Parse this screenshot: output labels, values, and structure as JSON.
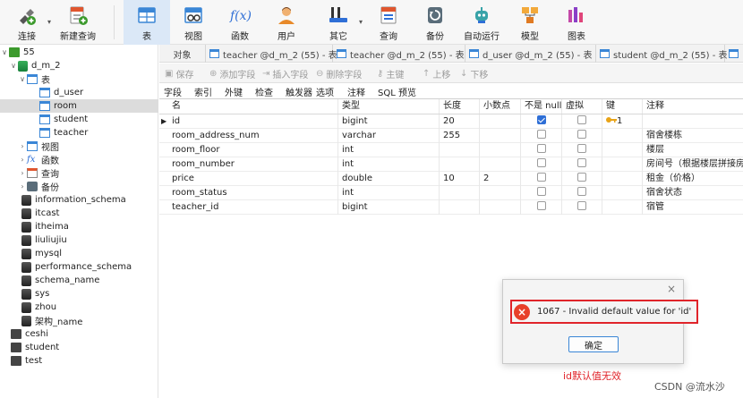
{
  "toolbar": {
    "items": [
      {
        "label": "连接",
        "icon": "connect-icon"
      },
      {
        "label": "新建查询",
        "icon": "new-query-icon"
      },
      {
        "label": "表",
        "icon": "table-icon"
      },
      {
        "label": "视图",
        "icon": "view-icon"
      },
      {
        "label": "函数",
        "icon": "function-icon",
        "glyph": "f(x)"
      },
      {
        "label": "用户",
        "icon": "user-icon"
      },
      {
        "label": "其它",
        "icon": "tools-icon"
      },
      {
        "label": "查询",
        "icon": "query-icon"
      },
      {
        "label": "备份",
        "icon": "backup-icon"
      },
      {
        "label": "自动运行",
        "icon": "robot-icon"
      },
      {
        "label": "模型",
        "icon": "model-icon"
      },
      {
        "label": "图表",
        "icon": "chart-icon"
      }
    ]
  },
  "sidebar": {
    "connection": "55",
    "database": "d_m_2",
    "tables_group": "表",
    "tables": [
      "d_user",
      "room",
      "student",
      "teacher"
    ],
    "groups": [
      "视图",
      "函数",
      "查询",
      "备份"
    ],
    "fx_glyph": "fx",
    "databases": [
      "information_schema",
      "itcast",
      "itheima",
      "liuliujiu",
      "mysql",
      "performance_schema",
      "schema_name",
      "sys",
      "zhou",
      "架构_name"
    ],
    "connections": [
      "ceshi",
      "student",
      "test"
    ]
  },
  "tabs": {
    "object": "对象",
    "items": [
      "teacher @d_m_2 (55) - 表",
      "teacher @d_m_2 (55) - 表",
      "d_user @d_m_2 (55) - 表",
      "student @d_m_2 (55) - 表"
    ]
  },
  "subtoolbar": {
    "save": "保存",
    "add_field": "添加字段",
    "insert_field": "插入字段",
    "delete_field": "删除字段",
    "primary_key": "主键",
    "move_up": "上移",
    "move_down": "下移"
  },
  "subtabs": [
    "字段",
    "索引",
    "外键",
    "检查",
    "触发器",
    "选项",
    "注释",
    "SQL 预览"
  ],
  "grid": {
    "headers": {
      "name": "名",
      "type": "类型",
      "length": "长度",
      "decimals": "小数点",
      "not_null": "不是 null",
      "virtual": "虚拟",
      "key": "键",
      "comment": "注释"
    },
    "rows": [
      {
        "name": "id",
        "type": "bigint",
        "length": "20",
        "decimals": "",
        "not_null": true,
        "virtual": false,
        "key": "1",
        "comment": ""
      },
      {
        "name": "room_address_num",
        "type": "varchar",
        "length": "255",
        "decimals": "",
        "not_null": false,
        "virtual": false,
        "key": "",
        "comment": "宿舍楼栋"
      },
      {
        "name": "room_floor",
        "type": "int",
        "length": "",
        "decimals": "",
        "not_null": false,
        "virtual": false,
        "key": "",
        "comment": "楼层"
      },
      {
        "name": "room_number",
        "type": "int",
        "length": "",
        "decimals": "",
        "not_null": false,
        "virtual": false,
        "key": "",
        "comment": "房间号（根据楼层拼接房间"
      },
      {
        "name": "price",
        "type": "double",
        "length": "10",
        "decimals": "2",
        "not_null": false,
        "virtual": false,
        "key": "",
        "comment": "租金（价格）"
      },
      {
        "name": "room_status",
        "type": "int",
        "length": "",
        "decimals": "",
        "not_null": false,
        "virtual": false,
        "key": "",
        "comment": "宿舍状态"
      },
      {
        "name": "teacher_id",
        "type": "bigint",
        "length": "",
        "decimals": "",
        "not_null": false,
        "virtual": false,
        "key": "",
        "comment": "宿管"
      }
    ]
  },
  "dialog": {
    "message": "1067 - Invalid default value for 'id'",
    "ok": "确定",
    "close_glyph": "×",
    "error_glyph": "×"
  },
  "annotation": "id默认值无效",
  "watermark": "CSDN @流水沙",
  "colors": {
    "accent": "#3a86d6",
    "error": "#e0242a",
    "selected_row": "#dcdcdc"
  }
}
